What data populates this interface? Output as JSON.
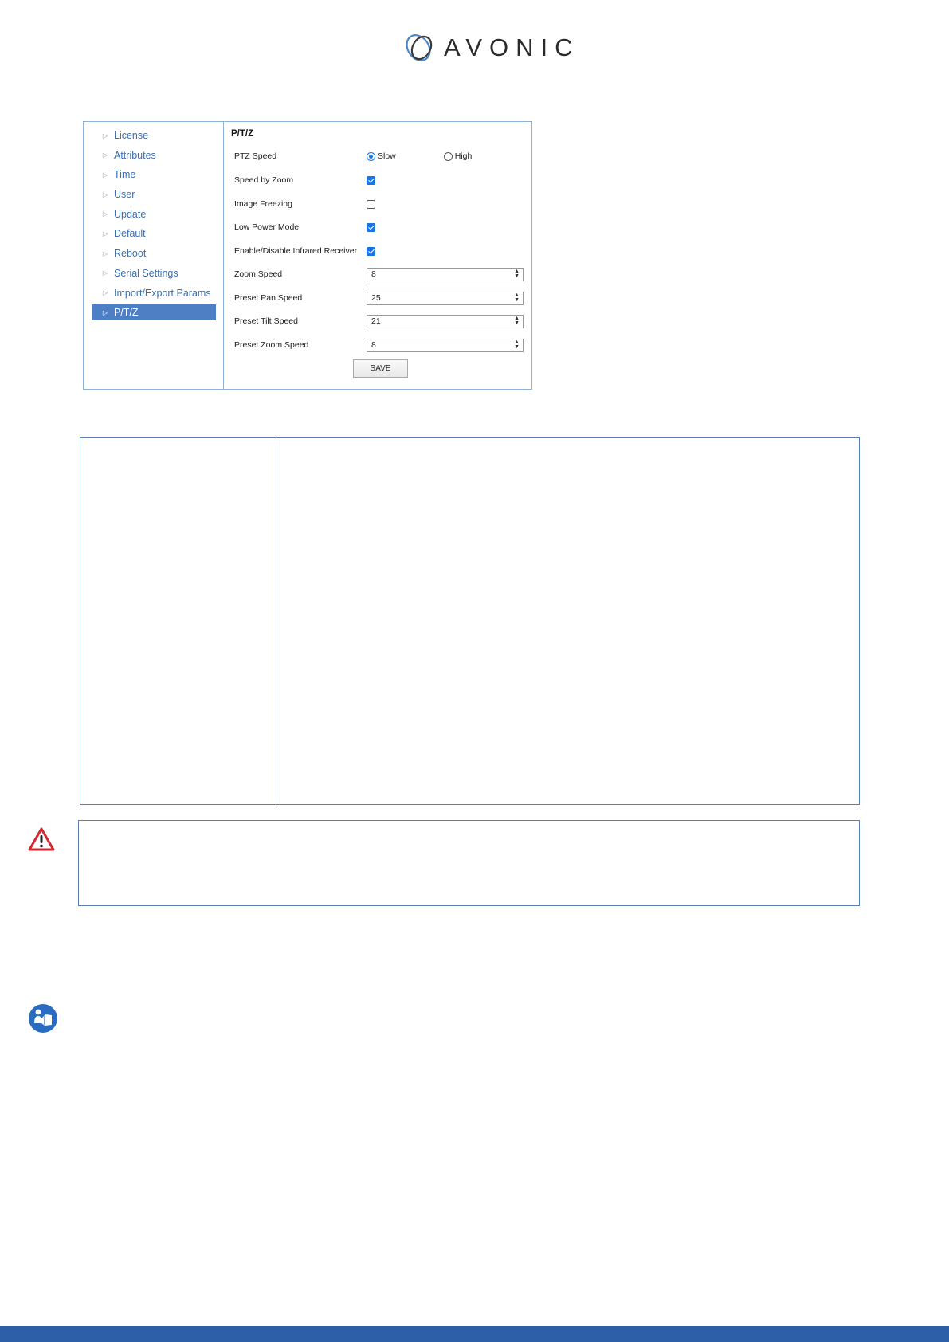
{
  "brand": {
    "name": "AVONIC",
    "accent": "#2d5ea8"
  },
  "sidebar": {
    "items": [
      {
        "label": "License",
        "active": false
      },
      {
        "label": "Attributes",
        "active": false
      },
      {
        "label": "Time",
        "active": false
      },
      {
        "label": "User",
        "active": false
      },
      {
        "label": "Update",
        "active": false
      },
      {
        "label": "Default",
        "active": false
      },
      {
        "label": "Reboot",
        "active": false
      },
      {
        "label": "Serial Settings",
        "active": false
      },
      {
        "label": "Import/Export Params",
        "active": false
      },
      {
        "label": "P/T/Z",
        "active": true
      }
    ]
  },
  "ptz": {
    "title": "P/T/Z",
    "ptz_speed": {
      "label": "PTZ Speed",
      "options": [
        "Slow",
        "High"
      ],
      "selected": "Slow"
    },
    "speed_by_zoom": {
      "label": "Speed by Zoom",
      "checked": true
    },
    "image_freezing": {
      "label": "Image Freezing",
      "checked": false
    },
    "low_power_mode": {
      "label": "Low Power Mode",
      "checked": true
    },
    "infrared_receiver": {
      "label": "Enable/Disable Infrared Receiver",
      "checked": true
    },
    "zoom_speed": {
      "label": "Zoom Speed",
      "value": "8"
    },
    "preset_pan_speed": {
      "label": "Preset Pan Speed",
      "value": "25"
    },
    "preset_tilt_speed": {
      "label": "Preset Tilt Speed",
      "value": "21"
    },
    "preset_zoom_speed": {
      "label": "Preset Zoom Speed",
      "value": "8"
    },
    "save_label": "SAVE"
  },
  "icons": {
    "warning": "warning-triangle-icon",
    "note": "read-manual-icon"
  }
}
